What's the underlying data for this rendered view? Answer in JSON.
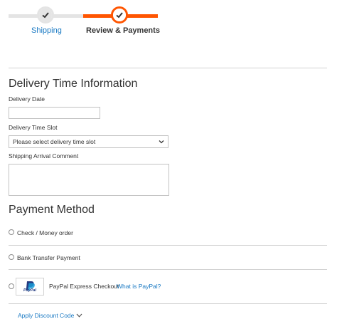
{
  "progress": {
    "steps": [
      {
        "label": "Shipping",
        "state": "complete"
      },
      {
        "label": "Review & Payments",
        "state": "active"
      }
    ],
    "accent_color": "#ff5501",
    "link_color": "#1979c3"
  },
  "delivery": {
    "title": "Delivery Time Information",
    "date_label": "Delivery Date",
    "date_value": "",
    "time_slot_label": "Delivery Time Slot",
    "time_slot_selected": "Please select delivery time slot",
    "comment_label": "Shipping Arrival Comment",
    "comment_value": ""
  },
  "payment": {
    "title": "Payment Method",
    "methods": [
      {
        "label": "Check / Money order",
        "selected": false
      },
      {
        "label": "Bank Transfer Payment",
        "selected": false
      },
      {
        "label": "PayPal Express Checkout",
        "selected": false,
        "help_link": "What is PayPal?",
        "logo_text": "PayPal"
      }
    ]
  },
  "discount": {
    "label": "Apply Discount Code"
  },
  "icons": {
    "step_complete": "checkmark-icon",
    "step_active": "checkmark-icon",
    "date_picker": "calendar-icon",
    "select": "chevron-down-icon",
    "discount_toggle": "chevron-down-icon"
  }
}
